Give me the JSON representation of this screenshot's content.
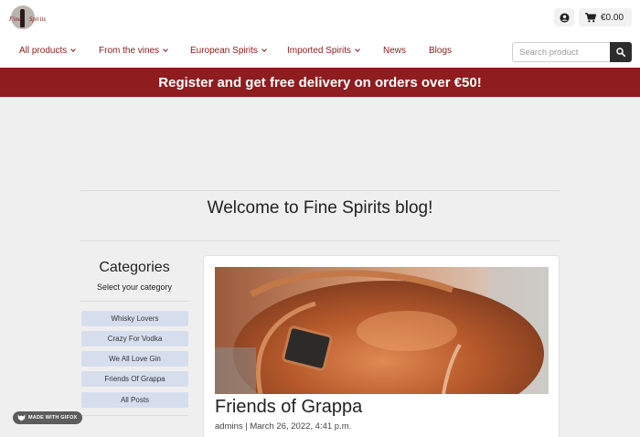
{
  "brand": {
    "logo_text_1": "Fine",
    "logo_text_2": "Spirits"
  },
  "header": {
    "cart_total": "€0.00"
  },
  "nav": {
    "items": [
      {
        "label": "All products",
        "dropdown": true
      },
      {
        "label": "From the vines",
        "dropdown": true
      },
      {
        "label": "European Spirits",
        "dropdown": true
      },
      {
        "label": "Imported Spirits",
        "dropdown": true
      },
      {
        "label": "News",
        "dropdown": false
      },
      {
        "label": "Blogs",
        "dropdown": false
      }
    ]
  },
  "search": {
    "placeholder": "Search product"
  },
  "banner": {
    "text": "Register and get free delivery on orders over €50!"
  },
  "page": {
    "title": "Welcome to Fine Spirits blog!"
  },
  "categories": {
    "title": "Categories",
    "subtitle": "Select your category",
    "items": [
      {
        "label": "Whisky Lovers"
      },
      {
        "label": "Crazy For Vodka"
      },
      {
        "label": "We All Love Gin"
      },
      {
        "label": "Friends Of Grappa"
      },
      {
        "label": "All Posts"
      }
    ]
  },
  "post": {
    "title": "Friends of Grappa",
    "meta": "admins | March 26, 2022, 4:41 p.m."
  },
  "watermark": {
    "text": "MADE WITH GIFOX"
  },
  "colors": {
    "brand_red": "#8f1c1f",
    "category_button": "#d6deee",
    "dark": "#2d2d2d"
  }
}
